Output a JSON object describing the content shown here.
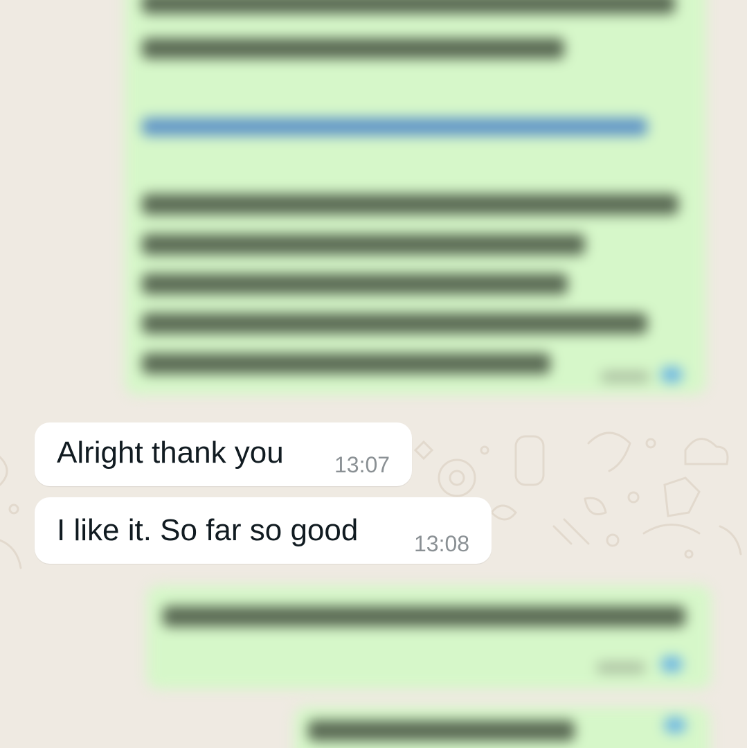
{
  "conversation": {
    "messages": [
      {
        "direction": "incoming",
        "text": "Alright thank you",
        "time": "13:07"
      },
      {
        "direction": "incoming",
        "text": "I like it. So far so good",
        "time": "13:08"
      }
    ]
  },
  "colors": {
    "wallpaper": "#efeae2",
    "incoming_bubble": "#ffffff",
    "outgoing_bubble": "#d6f7c9",
    "message_text": "#111b21",
    "timestamp_text": "#8a9094",
    "read_tick": "#53bdeb"
  }
}
